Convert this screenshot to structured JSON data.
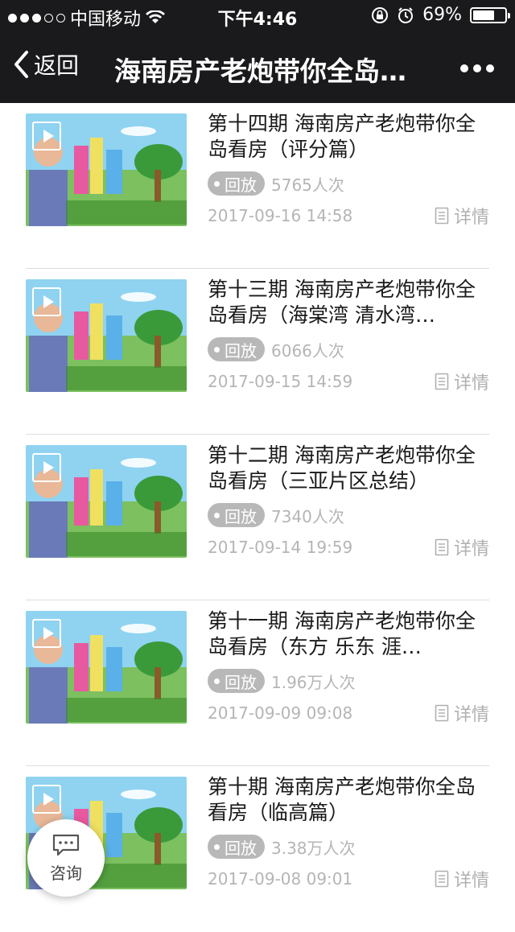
{
  "status_bar": {
    "carrier": "中国移动",
    "time": "下午4:46",
    "battery": "69%",
    "battery_level": 0.69
  },
  "nav": {
    "back_label": "返回",
    "title": "海南房产老炮带你全岛…",
    "more_icon": "ellipsis-icon"
  },
  "videos": [
    {
      "title": "第十四期 海南房产老炮带你全岛看房（评分篇）",
      "badge": "回放",
      "views": "5765人次",
      "date": "2017-09-16 14:58",
      "detail": "详情"
    },
    {
      "title": "第十三期 海南房产老炮带你全岛看房（海棠湾 清水湾…",
      "badge": "回放",
      "views": "6066人次",
      "date": "2017-09-15 14:59",
      "detail": "详情"
    },
    {
      "title": "第十二期 海南房产老炮带你全岛看房（三亚片区总结）",
      "badge": "回放",
      "views": "7340人次",
      "date": "2017-09-14 19:59",
      "detail": "详情"
    },
    {
      "title": "第十一期 海南房产老炮带你全岛看房（东方 乐东 涯…",
      "badge": "回放",
      "views": "1.96万人次",
      "date": "2017-09-09 09:08",
      "detail": "详情"
    },
    {
      "title": "第十期 海南房产老炮带你全岛看房（临高篇）",
      "badge": "回放",
      "views": "3.38万人次",
      "date": "2017-09-08 09:01",
      "detail": "详情"
    }
  ],
  "consult": {
    "label": "咨询",
    "icon": "chat-bubble-icon"
  },
  "colors": {
    "topbar": "#1a1a1c",
    "badge": "#b8b8b8",
    "meta_text": "#b5b5b5"
  }
}
